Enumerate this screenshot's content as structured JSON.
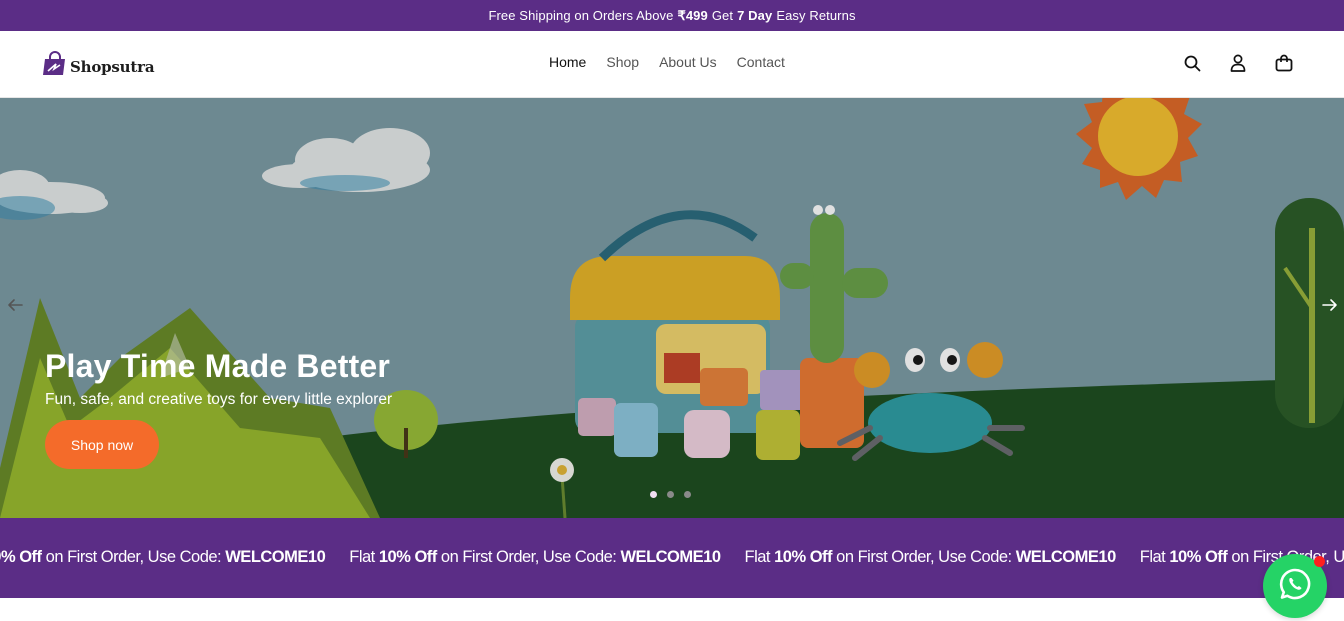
{
  "announcement": {
    "pre": "Free Shipping on Orders Above",
    "amount": "₹499",
    "mid": "Get",
    "days": "7 Day",
    "post": "Easy Returns"
  },
  "brand": {
    "name": "Shopsutra",
    "color": "#5b2d86"
  },
  "nav": {
    "items": [
      {
        "label": "Home",
        "active": true
      },
      {
        "label": "Shop",
        "active": false
      },
      {
        "label": "About Us",
        "active": false
      },
      {
        "label": "Contact",
        "active": false
      }
    ]
  },
  "header_icons": [
    "search-icon",
    "account-icon",
    "cart-icon"
  ],
  "hero": {
    "title": "Play Time Made Better",
    "subtitle": "Fun, safe, and creative toys for every little explorer",
    "cta": "Shop now",
    "cta_color": "#f46b2a",
    "slides_total": 3,
    "active_slide": 1
  },
  "marquee": {
    "prefix": "Flat",
    "discount": "10% Off",
    "middle": "on First Order, Use Code:",
    "code": "WELCOME10"
  },
  "whatsapp": {
    "icon": "whatsapp-icon",
    "color": "#25d366",
    "has_notification": true
  }
}
